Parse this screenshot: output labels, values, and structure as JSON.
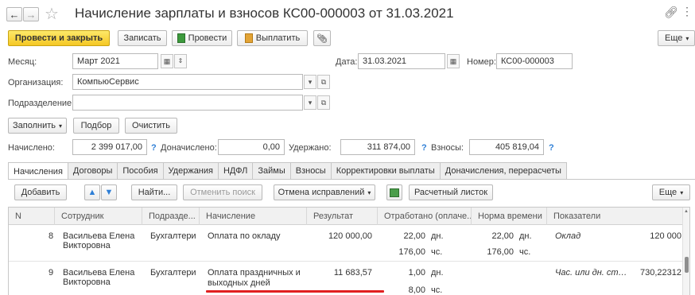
{
  "title": "Начисление зарплаты и взносов КС00-000003 от 31.03.2021",
  "toolbar": {
    "post_close": "Провести и закрыть",
    "save": "Записать",
    "post": "Провести",
    "pay": "Выплатить",
    "more": "Еще"
  },
  "form": {
    "month_label": "Месяц:",
    "month_value": "Март 2021",
    "date_label": "Дата:",
    "date_value": "31.03.2021",
    "number_label": "Номер:",
    "number_value": "КС00-000003",
    "org_label": "Организация:",
    "org_value": "КомпьюСервис",
    "dept_label": "Подразделение:",
    "dept_value": ""
  },
  "actions": {
    "fill": "Заполнить",
    "select": "Подбор",
    "clear": "Очистить"
  },
  "totals": {
    "accrued_label": "Начислено:",
    "accrued_value": "2 399 017,00",
    "extra_label": "Доначислено:",
    "extra_value": "0,00",
    "withheld_label": "Удержано:",
    "withheld_value": "311 874,00",
    "contrib_label": "Взносы:",
    "contrib_value": "405 819,04",
    "q": "?"
  },
  "tabs": [
    "Начисления",
    "Договоры",
    "Пособия",
    "Удержания",
    "НДФЛ",
    "Займы",
    "Взносы",
    "Корректировки выплаты",
    "Доначисления, перерасчеты"
  ],
  "table_toolbar": {
    "add": "Добавить",
    "find": "Найти...",
    "cancel_search": "Отменить поиск",
    "cancel_fixes": "Отмена исправлений",
    "payslip": "Расчетный листок",
    "more": "Еще"
  },
  "columns": [
    "N",
    "Сотрудник",
    "Подразде...",
    "Начисление",
    "Результат",
    "Отработано (оплаче...",
    "Норма времени",
    "Показатели"
  ],
  "rows": [
    {
      "n": "8",
      "employee_1": "Васильева Елена",
      "employee_2": "Викторовна",
      "dept": "Бухгалтери",
      "accrual_1": "Оплата по окладу",
      "accrual_2": "",
      "result": "120 000,00",
      "worked_days": "22,00",
      "days_unit": "дн.",
      "worked_hours": "176,00",
      "hours_unit": "чс.",
      "norm_days": "22,00",
      "norm_days_unit": "дн.",
      "norm_hours": "176,00",
      "norm_hours_unit": "чс.",
      "indicator": "Оклад",
      "indicator_value": "120 000"
    },
    {
      "n": "9",
      "employee_1": "Васильева Елена",
      "employee_2": "Викторовна",
      "dept": "Бухгалтери",
      "accrual_1": "Оплата праздничных и",
      "accrual_2": "выходных дней",
      "result": "11 683,57",
      "worked_days": "1,00",
      "days_unit": "дн.",
      "worked_hours": "8,00",
      "hours_unit": "чс.",
      "norm_days": "",
      "norm_days_unit": "",
      "norm_hours": "",
      "norm_hours_unit": "",
      "indicator": "Час. или дн. ст…",
      "indicator_value": "730,22312"
    }
  ],
  "colors": {
    "accent_yellow": "#f5c724",
    "link_blue": "#2f7fd6",
    "underline_red": "#e02020"
  }
}
